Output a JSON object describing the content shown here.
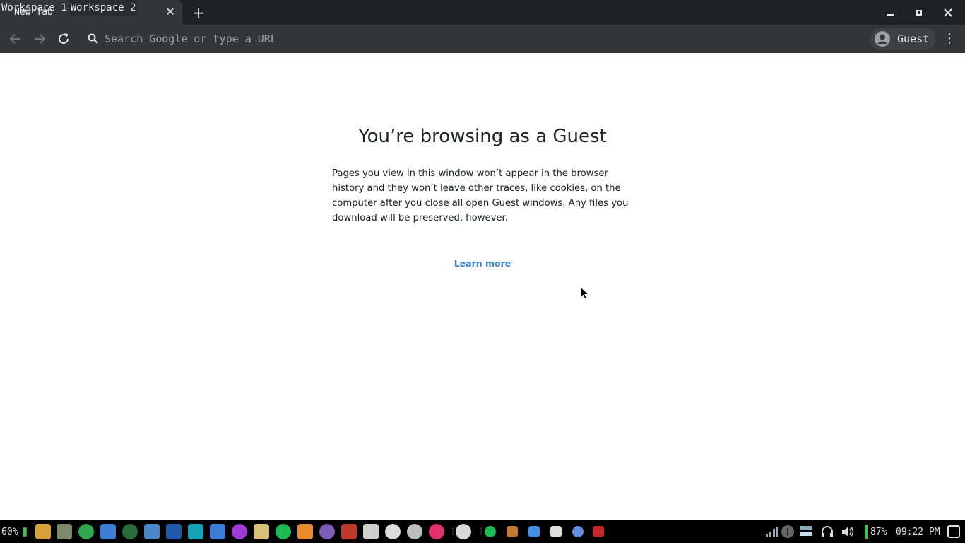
{
  "workspaces": [
    {
      "label": "Workspace 1"
    },
    {
      "label": "Workspace 2"
    }
  ],
  "tabs": [
    {
      "title": "New Tab"
    }
  ],
  "toolbar": {
    "back_icon": "arrow-back-icon",
    "forward_icon": "arrow-forward-icon",
    "reload_icon": "reload-icon",
    "omnibox_placeholder": "Search Google or type a URL",
    "profile_name": "Guest"
  },
  "page": {
    "title": "You’re browsing as a Guest",
    "description": "Pages you view in this window won’t appear in the browser history and they won’t leave other traces, like cookies, on the computer after you close all open Guest windows. Any files you download will be preserved, however.",
    "learn_more": "Learn more"
  },
  "colors": {
    "chrome_dark": "#35363a",
    "tabstrip": "#202124",
    "link": "#3b7fd6",
    "battery_green": "#2ecc40"
  },
  "taskbar": {
    "battery_left": "60%",
    "apps": [
      {
        "name": "file-manager-icon",
        "color": "#d9a13b"
      },
      {
        "name": "archive-icon",
        "color": "#7a8a6a"
      },
      {
        "name": "maps-icon",
        "color": "#2fa84f"
      },
      {
        "name": "package-icon",
        "color": "#3b7fd6"
      },
      {
        "name": "globe-icon",
        "color": "#2a6d3a"
      },
      {
        "name": "web-browser-icon",
        "color": "#4a86c8"
      },
      {
        "name": "feather-icon",
        "color": "#1e5aa8"
      },
      {
        "name": "lightning-icon",
        "color": "#17a2b8"
      },
      {
        "name": "monitor-icon",
        "color": "#3d7bd9"
      },
      {
        "name": "firefox-icon",
        "color": "#a23ad8"
      },
      {
        "name": "clipboard-icon",
        "color": "#d8c07a"
      },
      {
        "name": "spotify-icon",
        "color": "#1db954"
      },
      {
        "name": "sublime-text-icon",
        "color": "#e8892b"
      },
      {
        "name": "emacs-icon",
        "color": "#7f5ab6"
      },
      {
        "name": "terminal-red-icon",
        "color": "#c0392b"
      },
      {
        "name": "notes-icon",
        "color": "#cfcfcf"
      },
      {
        "name": "inkscape-icon",
        "color": "#dcdcdc"
      },
      {
        "name": "incognito-icon",
        "color": "#bdbdbd"
      },
      {
        "name": "firefox-dev-icon",
        "color": "#e0306e"
      },
      {
        "name": "user-avatar-icon",
        "color": "#dadada"
      },
      {
        "name": "spotify-small-icon",
        "color": "#1db954"
      },
      {
        "name": "sublime-small-icon",
        "color": "#c47a2c"
      },
      {
        "name": "chromium-small-icon",
        "color": "#3f8ee8"
      },
      {
        "name": "folder-icon",
        "color": "#dedede"
      },
      {
        "name": "chrome-icon",
        "color": "#5f8fdc"
      },
      {
        "name": "terminal-icon",
        "color": "#c62828"
      }
    ],
    "tray": [
      {
        "name": "network-icon"
      },
      {
        "name": "info-icon"
      },
      {
        "name": "display-icon"
      },
      {
        "name": "headphones-icon"
      },
      {
        "name": "volume-icon"
      }
    ],
    "battery": "87%",
    "clock": "09:22 PM",
    "logout_icon": "logout-icon"
  }
}
